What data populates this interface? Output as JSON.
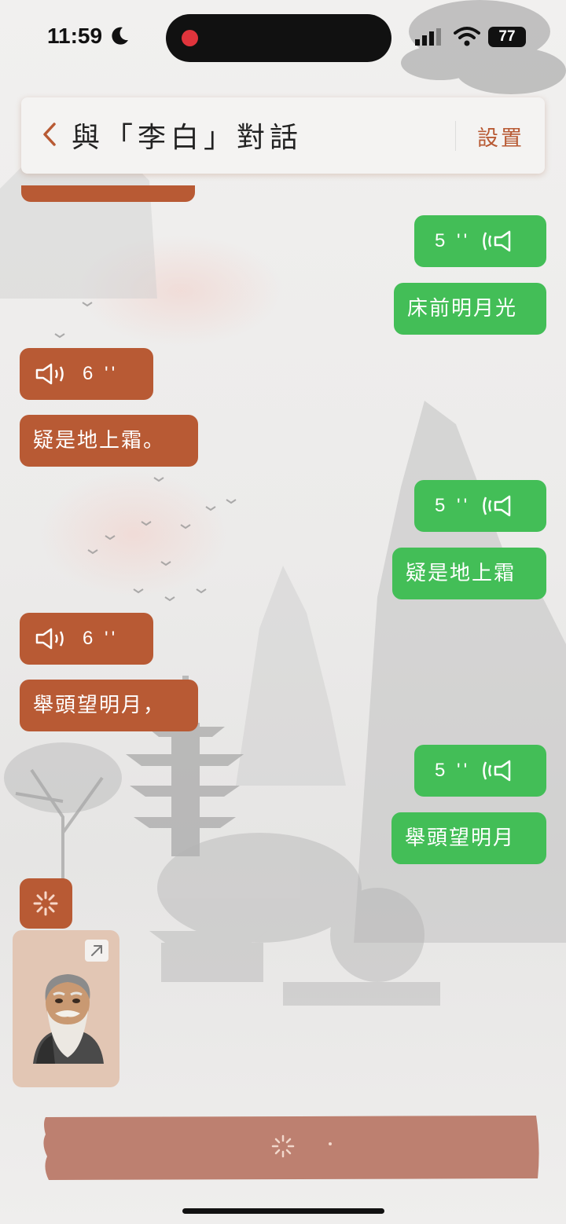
{
  "status_bar": {
    "time": "11:59",
    "battery": "77",
    "icons": [
      "moon-icon",
      "recording-dot",
      "signal-icon",
      "wifi-icon",
      "battery-icon"
    ]
  },
  "header": {
    "title": "與「李白」對話",
    "settings_label": "設置",
    "back_icon": "chevron-left-icon"
  },
  "colors": {
    "user_bubble": "#43be57",
    "bot_bubble": "#b85a34",
    "accent": "#b85a34",
    "input_bar": "#bd8070"
  },
  "messages": [
    {
      "sender": "user",
      "type": "voice",
      "duration": "5 ''"
    },
    {
      "sender": "user",
      "type": "text",
      "text": "床前明月光"
    },
    {
      "sender": "bot",
      "type": "voice",
      "duration": "6 ''"
    },
    {
      "sender": "bot",
      "type": "text",
      "text": "疑是地上霜。"
    },
    {
      "sender": "user",
      "type": "voice",
      "duration": "5 ''"
    },
    {
      "sender": "user",
      "type": "text",
      "text": "疑是地上霜"
    },
    {
      "sender": "bot",
      "type": "voice",
      "duration": "6 ''"
    },
    {
      "sender": "bot",
      "type": "text",
      "text": "舉頭望明月，"
    },
    {
      "sender": "user",
      "type": "voice",
      "duration": "5 ''"
    },
    {
      "sender": "user",
      "type": "text",
      "text": "舉頭望明月"
    },
    {
      "sender": "bot",
      "type": "loading"
    }
  ],
  "avatar_card": {
    "expand_icon": "arrow-up-right-icon",
    "avatar": "li-bai-avatar"
  },
  "input_bar": {
    "icon": "loading-spinner-icon"
  }
}
